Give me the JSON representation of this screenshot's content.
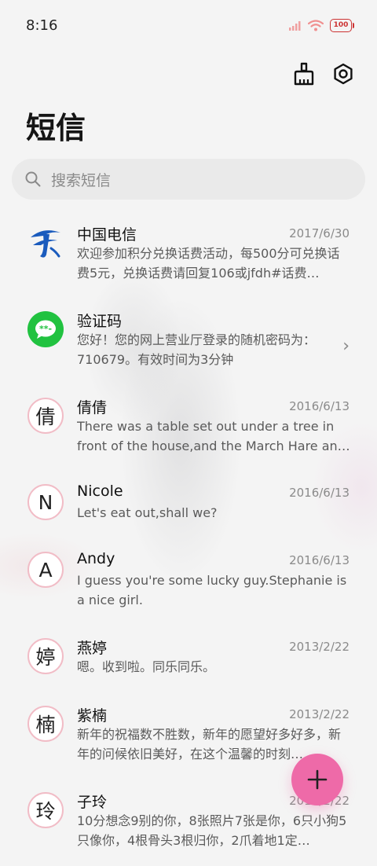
{
  "status_bar": {
    "time": "8:16",
    "battery": "100",
    "signal_icon": "signal-icon",
    "wifi_icon": "wifi-icon",
    "accent_color": "#cc3333"
  },
  "toolbar": {
    "clean_icon": "broom-icon",
    "settings_icon": "gear-icon"
  },
  "page": {
    "title": "短信"
  },
  "search": {
    "placeholder": "搜索短信"
  },
  "messages": [
    {
      "sender": "中国电信",
      "date": "2017/6/30",
      "snippet": "欢迎参加积分兑换话费活动，每500分可兑换话费5元，兑换话费请回复106或jfdh#话费…",
      "avatar": "telecom-logo"
    },
    {
      "sender": "验证码",
      "date": "",
      "snippet": "您好！您的网上营业厅登录的随机密码为：710679。有效时间为3分钟",
      "avatar": "message-icon"
    },
    {
      "sender": "倩倩",
      "date": "2016/6/13",
      "snippet": "There was a table set out under a tree in front of the house,and the March Hare an…",
      "avatar": "倩"
    },
    {
      "sender": "Nicole",
      "date": "2016/6/13",
      "snippet": "Let's eat out,shall we?",
      "avatar": "N"
    },
    {
      "sender": "Andy",
      "date": "2016/6/13",
      "snippet": "I guess you're some lucky guy.Stephanie is a nice girl.",
      "avatar": "A"
    },
    {
      "sender": "燕婷",
      "date": "2013/2/22",
      "snippet": "嗯。收到啦。同乐同乐。",
      "avatar": "婷"
    },
    {
      "sender": "紫楠",
      "date": "2013/2/22",
      "snippet": "新年的祝福数不胜数，新年的愿望好多好多，新年的问候依旧美好，在这个温馨的时刻…",
      "avatar": "楠"
    },
    {
      "sender": "子玲",
      "date": "2013/2/22",
      "snippet": "10分想念9别的你，8张照片7张是你，6只小狗5只像你，4根骨头3根归你，2爪着地1定…",
      "avatar": "玲"
    }
  ],
  "fab": {
    "icon": "plus-icon",
    "color": "#ee6aa8"
  }
}
